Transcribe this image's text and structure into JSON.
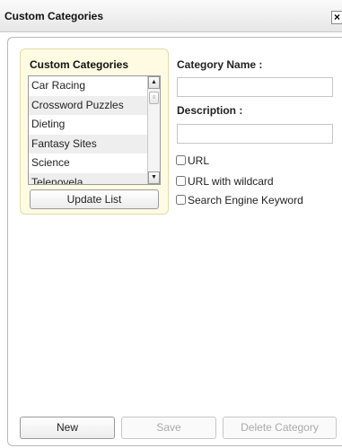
{
  "dialog": {
    "title": "Custom Categories",
    "close_label": "×"
  },
  "categories_panel": {
    "title": "Custom Categories",
    "items": [
      "Car Racing",
      "Crossword Puzzles",
      "Dieting",
      "Fantasy Sites",
      "Science",
      "Telenovela"
    ],
    "scroll_up_icon": "▲",
    "scroll_down_icon": "▼",
    "scroll_grip_icon": "≡",
    "update_button_label": "Update List"
  },
  "form": {
    "category_name_label": "Category Name :",
    "category_name_value": "",
    "description_label": "Description :",
    "description_value": "",
    "options": [
      {
        "label": "URL",
        "checked": false
      },
      {
        "label": "URL with wildcard",
        "checked": false
      },
      {
        "label": "Search Engine Keyword",
        "checked": false
      }
    ]
  },
  "footer": {
    "new_label": "New",
    "save_label": "Save",
    "delete_label": "Delete Category"
  }
}
